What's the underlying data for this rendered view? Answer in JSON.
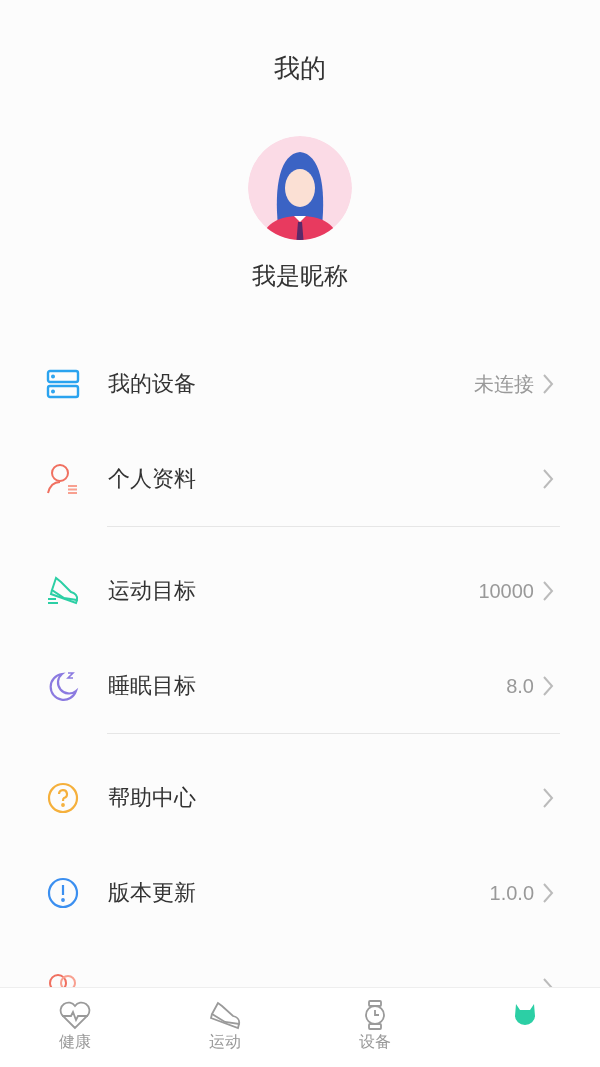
{
  "title": "我的",
  "profile": {
    "nickname": "我是昵称"
  },
  "groups": [
    {
      "items": [
        {
          "kind": "device",
          "label": "我的设备",
          "value": "未连接"
        },
        {
          "kind": "profile",
          "label": "个人资料"
        }
      ]
    },
    {
      "items": [
        {
          "kind": "steps",
          "label": "运动目标",
          "value": "10000"
        },
        {
          "kind": "sleep",
          "label": "睡眠目标",
          "value": "8.0"
        }
      ]
    },
    {
      "items": [
        {
          "kind": "help",
          "label": "帮助中心"
        },
        {
          "kind": "version",
          "label": "版本更新",
          "value": "1.0.0"
        },
        {
          "kind": "about"
        }
      ]
    }
  ],
  "tabs": [
    {
      "kind": "health",
      "label": "健康",
      "selected": false
    },
    {
      "kind": "sport",
      "label": "运动",
      "selected": false
    },
    {
      "kind": "device",
      "label": "设备",
      "selected": false
    },
    {
      "kind": "mine",
      "selected": true
    }
  ]
}
